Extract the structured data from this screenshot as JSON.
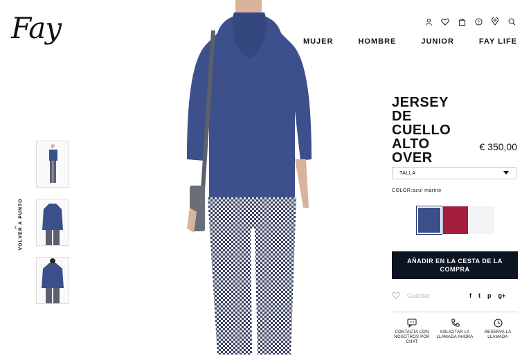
{
  "brand": {
    "logo_text": "Fay"
  },
  "header_icons": [
    "user-icon",
    "heart-icon",
    "bag-icon",
    "help-icon",
    "location-icon",
    "search-icon"
  ],
  "nav": [
    "MUJER",
    "HOMBRE",
    "JUNIOR",
    "FAY LIFE"
  ],
  "back_link": "VOLVER A PUNTO",
  "product": {
    "title": "JERSEY DE CUELLO ALTO OVER",
    "price": "€ 350,00",
    "size_placeholder": "TALLA",
    "color_label": "COLOR:",
    "color_value": "azul marino",
    "swatches": [
      "#3b4f8a",
      "#a31e3c",
      "#f3f3f6"
    ],
    "add_to_cart": "AÑADIR EN LA CESTA DE LA COMPRA",
    "save_label": "Guardar"
  },
  "social": [
    "f",
    "t",
    "p",
    "g+"
  ],
  "contacts": [
    {
      "label": "CONTACTA CON NOSOTROS POR CHAT"
    },
    {
      "label": "SOLICITAR LA LLAMADA AHORA"
    },
    {
      "label": "RESERVA LA LLAMADA"
    }
  ],
  "colors": {
    "accent": "#0d1421",
    "sweater": "#3b4f8a"
  }
}
